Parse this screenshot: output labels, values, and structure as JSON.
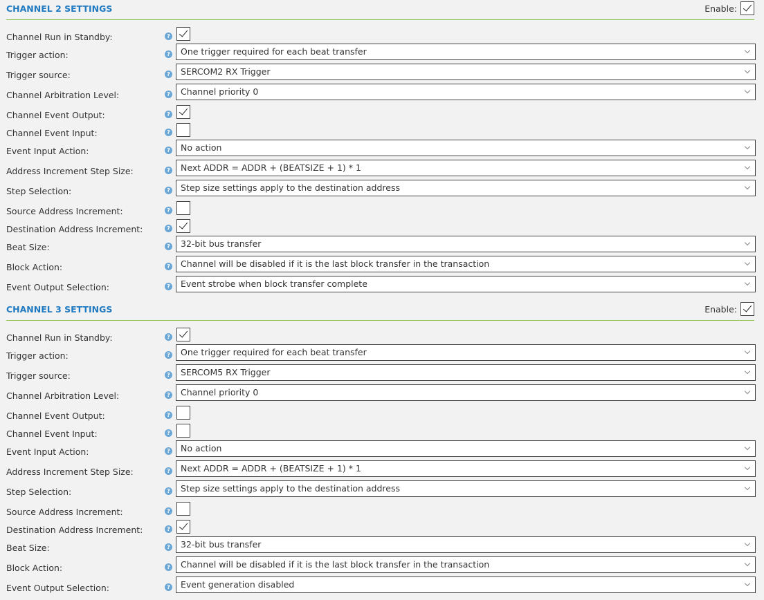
{
  "channels": [
    {
      "title": "CHANNEL 2 SETTINGS",
      "enable_label": "Enable:",
      "enabled": true,
      "fields": [
        {
          "label": "Channel Run in Standby:",
          "type": "checkbox",
          "checked": true
        },
        {
          "label": "Trigger action:",
          "type": "select",
          "value": "One trigger required for each beat transfer"
        },
        {
          "label": "Trigger source:",
          "type": "select",
          "value": "SERCOM2 RX Trigger"
        },
        {
          "label": "Channel Arbitration Level:",
          "type": "select",
          "value": "Channel priority 0"
        },
        {
          "label": "Channel Event Output:",
          "type": "checkbox",
          "checked": true
        },
        {
          "label": "Channel Event Input:",
          "type": "checkbox",
          "checked": false
        },
        {
          "label": "Event Input Action:",
          "type": "select",
          "value": "No action"
        },
        {
          "label": "Address Increment Step Size:",
          "type": "select",
          "value": "Next ADDR = ADDR + (BEATSIZE + 1) * 1"
        },
        {
          "label": "Step Selection:",
          "type": "select",
          "value": "Step size settings apply to the destination address"
        },
        {
          "label": "Source Address Increment:",
          "type": "checkbox",
          "checked": false
        },
        {
          "label": "Destination Address Increment:",
          "type": "checkbox",
          "checked": true
        },
        {
          "label": "Beat Size:",
          "type": "select",
          "value": "32-bit bus transfer"
        },
        {
          "label": "Block Action:",
          "type": "select",
          "value": "Channel will be disabled if it is the last block transfer in the transaction"
        },
        {
          "label": "Event Output Selection:",
          "type": "select",
          "value": "Event strobe when block transfer complete"
        }
      ]
    },
    {
      "title": "CHANNEL 3 SETTINGS",
      "enable_label": "Enable:",
      "enabled": true,
      "fields": [
        {
          "label": "Channel Run in Standby:",
          "type": "checkbox",
          "checked": true
        },
        {
          "label": "Trigger action:",
          "type": "select",
          "value": "One trigger required for each beat transfer"
        },
        {
          "label": "Trigger source:",
          "type": "select",
          "value": "SERCOM5 RX Trigger"
        },
        {
          "label": "Channel Arbitration Level:",
          "type": "select",
          "value": "Channel priority 0"
        },
        {
          "label": "Channel Event Output:",
          "type": "checkbox",
          "checked": false
        },
        {
          "label": "Channel Event Input:",
          "type": "checkbox",
          "checked": false
        },
        {
          "label": "Event Input Action:",
          "type": "select",
          "value": "No action"
        },
        {
          "label": "Address Increment Step Size:",
          "type": "select",
          "value": "Next ADDR = ADDR + (BEATSIZE + 1) * 1"
        },
        {
          "label": "Step Selection:",
          "type": "select",
          "value": "Step size settings apply to the destination address"
        },
        {
          "label": "Source Address Increment:",
          "type": "checkbox",
          "checked": false
        },
        {
          "label": "Destination Address Increment:",
          "type": "checkbox",
          "checked": true
        },
        {
          "label": "Beat Size:",
          "type": "select",
          "value": "32-bit bus transfer"
        },
        {
          "label": "Block Action:",
          "type": "select",
          "value": "Channel will be disabled if it is the last block transfer in the transaction"
        },
        {
          "label": "Event Output Selection:",
          "type": "select",
          "value": "Event generation disabled"
        }
      ]
    }
  ],
  "icons": {
    "help": "help-icon",
    "dropdown": "chevron-down-icon",
    "check": "checkmark-icon"
  },
  "colors": {
    "section_title": "#1f7ac1",
    "divider": "#8bc34a",
    "help_icon": "#6ba7d6",
    "background": "#f2f2f2"
  }
}
